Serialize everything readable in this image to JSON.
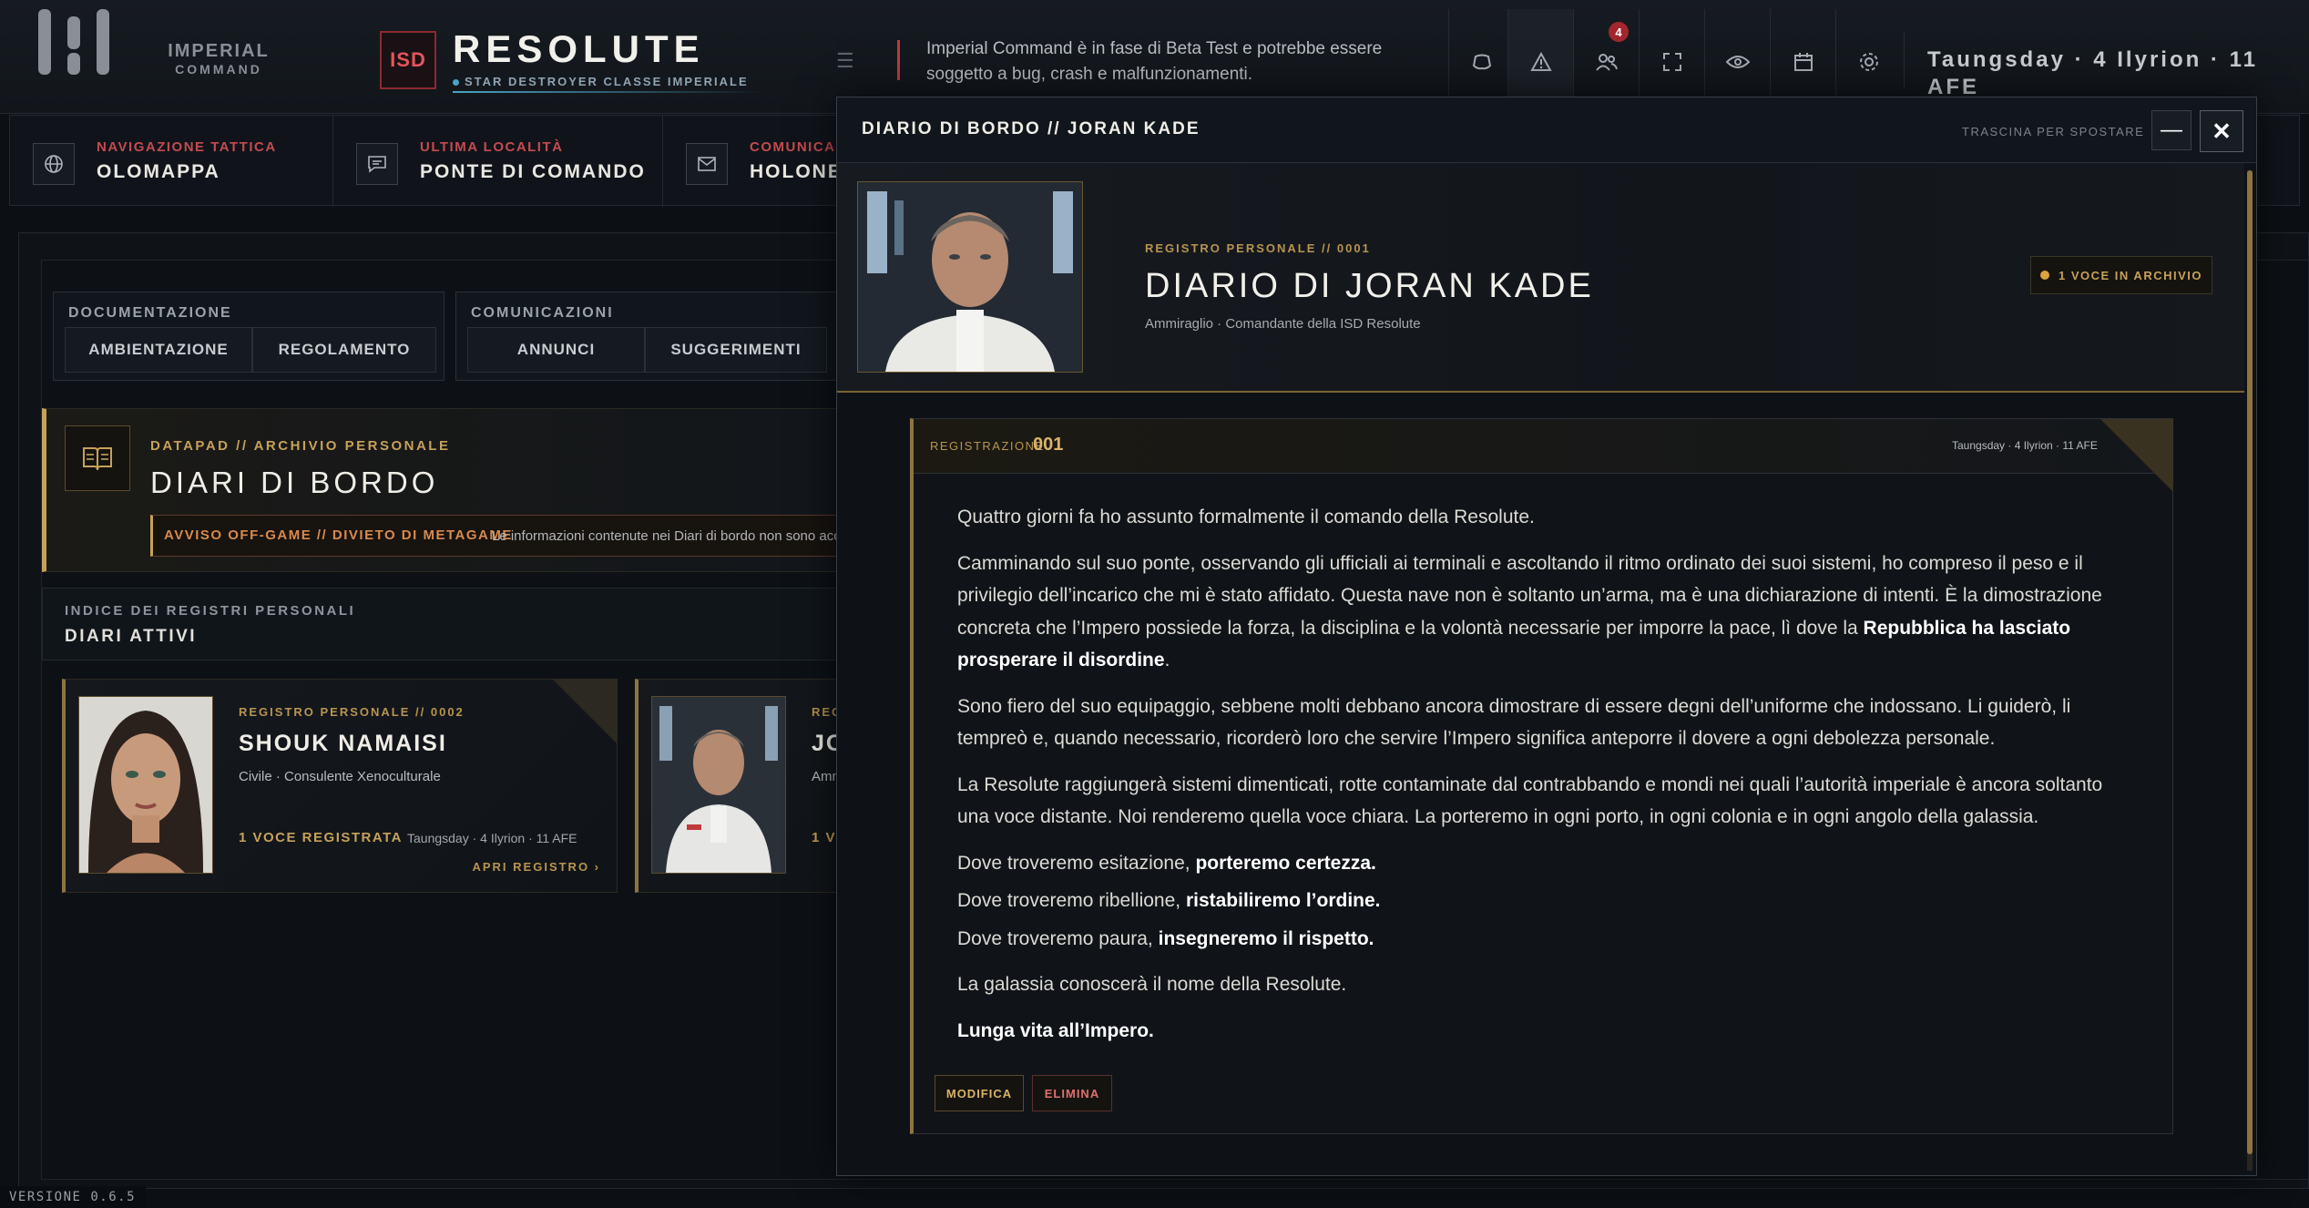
{
  "app": {
    "brand_line1": "IMPERIAL",
    "brand_line2": "COMMAND",
    "ship_prefix": "ISD",
    "ship_name": "RESOLUTE",
    "ship_class": "STAR DESTROYER CLASSE IMPERIALE",
    "beta_notice": "Imperial Command è in fase di Beta Test e potrebbe essere soggetto a bug, crash e malfunzionamenti.",
    "date": "Taungsday · 4 Ilyrion · 11 AFE",
    "notifications_count": "4",
    "version": "VERSIONE 0.6.5"
  },
  "toolbar": {
    "icons": [
      "discord-icon",
      "alert-icon",
      "users-icon",
      "fullscreen-icon",
      "eye-icon",
      "calendar-icon",
      "settings-icon"
    ]
  },
  "nav": [
    {
      "label": "NAVIGAZIONE TATTICA",
      "value": "OLOMAPPA",
      "icon": "globe-icon"
    },
    {
      "label": "ULTIMA LOCALITÀ",
      "value": "PONTE DI COMANDO",
      "icon": "chat-icon"
    },
    {
      "label": "COMUNICAZ",
      "value": "HOLONET",
      "icon": "mail-icon"
    }
  ],
  "tabs": {
    "documentazione": {
      "title": "DOCUMENTAZIONE",
      "items": [
        "AMBIENTAZIONE",
        "REGOLAMENTO"
      ]
    },
    "comunicazioni": {
      "title": "COMUNICAZIONI",
      "items": [
        "ANNUNCI",
        "SUGGERIMENTI"
      ]
    }
  },
  "diari": {
    "kicker": "DATAPAD // ARCHIVIO PERSONALE",
    "title": "DIARI DI BORDO",
    "avviso_label": "AVVISO OFF-GAME // DIVIETO DI METAGAME",
    "avviso_text": "Le informazioni contenute nei Diari di bordo non sono acc"
  },
  "indice": {
    "kicker": "INDICE DEI REGISTRI PERSONALI",
    "title": "DIARI ATTIVI"
  },
  "cards": [
    {
      "kicker": "REGISTRO PERSONALE // 0002",
      "name": "SHOUK NAMAISI",
      "role": "Civile · Consulente Xenoculturale",
      "count": "1 VOCE REGISTRATA",
      "date": "Taungsday · 4 Ilyrion · 11 AFE",
      "open": "APRI REGISTRO ›"
    },
    {
      "kicker": "REG",
      "name": "JO",
      "role": "Amm",
      "count": "1 V"
    }
  ],
  "modal": {
    "title": "DIARIO DI BORDO // JORAN KADE",
    "drag_hint": "TRASCINA PER SPOSTARE",
    "minimize": "—",
    "close": "✕",
    "kicker": "REGISTRO PERSONALE // 0001",
    "name": "DIARIO DI JORAN KADE",
    "role": "Ammiraglio · Comandante della ISD Resolute",
    "badge": "1 VOCE IN ARCHIVIO",
    "entry": {
      "label": "REGISTRAZIONE",
      "number": "001",
      "date": "Taungsday · 4 Ilyrion · 11 AFE",
      "p1": "Quattro giorni fa ho assunto formalmente il comando della Resolute.",
      "p2a": "Camminando sul suo ponte, osservando gli ufficiali ai terminali e ascoltando il ritmo ordinato dei suoi sistemi, ho compreso il peso e il privilegio dell’incarico che mi è stato affidato. Questa nave non è soltanto un’arma, ma è una dichiarazione di intenti. È la dimostrazione concreta che l’Impero possiede la forza, la disciplina e la volontà necessarie per imporre la pace, lì dove la ",
      "p2b": "Repubblica ha lasciato prosperare il disordine",
      "p2c": ".",
      "p3": "Sono fiero del suo equipaggio, sebbene molti debbano ancora dimostrare di essere degni dell’uniforme che indossano. Li guiderò, li tempreò e, quando necessario, ricorderò loro che servire l’Impero significa anteporre il dovere a ogni debolezza personale.",
      "p4": "La Resolute raggiungerà sistemi dimenticati, rotte contaminate dal contrabbando e mondi nei quali l’autorità imperiale è ancora soltanto una voce distante. Noi renderemo quella voce chiara. La porteremo in ogni porto, in ogni colonia e in ogni angolo della galassia.",
      "l1a": "Dove troveremo esitazione, ",
      "l1b": "porteremo certezza.",
      "l2a": "Dove troveremo ribellione, ",
      "l2b": "ristabiliremo l’ordine.",
      "l3a": "Dove troveremo paura, ",
      "l3b": "insegneremo il rispetto.",
      "p5": "La galassia conoscerà il nome della Resolute.",
      "p6": "Lunga vita all’Impero.",
      "edit": "MODIFICA",
      "delete": "ELIMINA"
    }
  },
  "colors": {
    "accent_gold": "#c6a15a",
    "accent_red": "#d0474f",
    "background": "#0c1015"
  }
}
